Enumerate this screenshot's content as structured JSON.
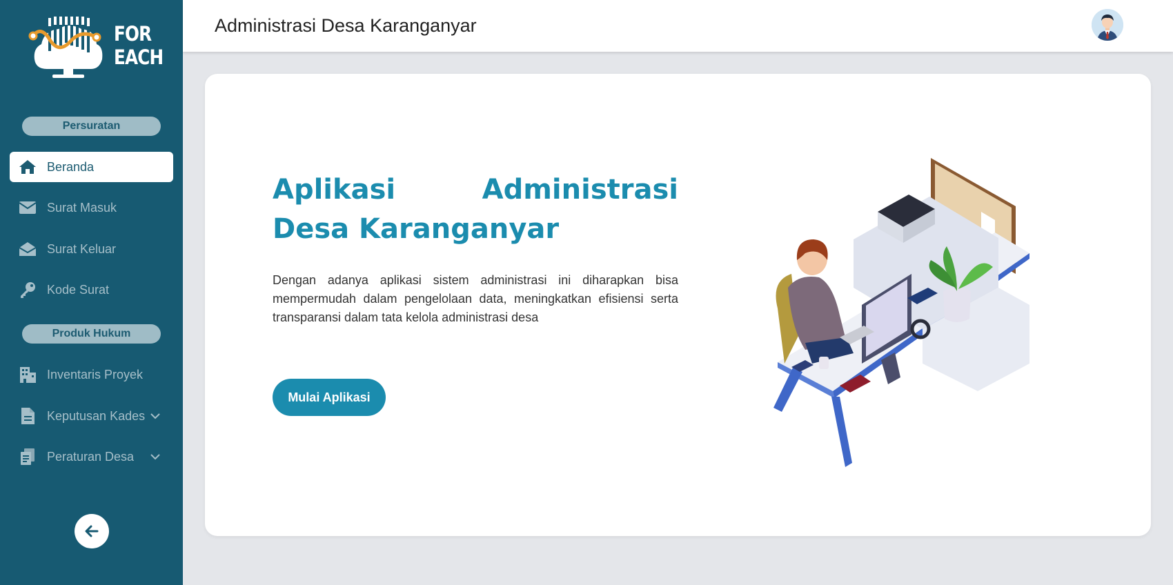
{
  "app": {
    "logo_text_line1": "FOR",
    "logo_text_line2": "EACH",
    "page_title": "Administrasi Desa Karanganyar"
  },
  "sidebar": {
    "section1": "Persuratan",
    "section2": "Produk Hukum",
    "items": [
      {
        "label": "Beranda",
        "icon": "home-icon"
      },
      {
        "label": "Surat Masuk",
        "icon": "envelope-icon"
      },
      {
        "label": "Surat Keluar",
        "icon": "envelope-open-icon"
      },
      {
        "label": "Kode Surat",
        "icon": "key-icon"
      },
      {
        "label": "Inventaris Proyek",
        "icon": "building-icon"
      },
      {
        "label": "Keputusan Kades",
        "icon": "document-icon"
      },
      {
        "label": "Peraturan Desa",
        "icon": "documents-icon"
      }
    ]
  },
  "hero": {
    "title": "Aplikasi Administrasi Desa Karanganyar",
    "description": "Dengan adanya aplikasi sistem administrasi ini diharapkan bisa mempermudah dalam pengelolaan data, meningkatkan efisiensi serta transparansi dalam tata kelola administrasi desa",
    "button": "Mulai Aplikasi"
  },
  "colors": {
    "sidebar": "#175a72",
    "accent": "#1b8cae",
    "background": "#e4e6ea"
  }
}
